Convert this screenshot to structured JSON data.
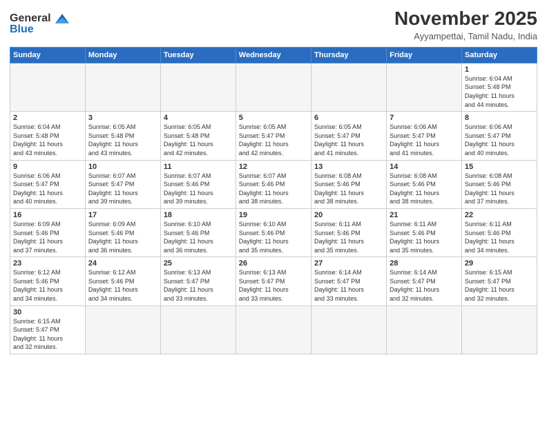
{
  "logo": {
    "general": "General",
    "blue": "Blue"
  },
  "header": {
    "month_title": "November 2025",
    "subtitle": "Ayyampettai, Tamil Nadu, India"
  },
  "days_of_week": [
    "Sunday",
    "Monday",
    "Tuesday",
    "Wednesday",
    "Thursday",
    "Friday",
    "Saturday"
  ],
  "weeks": [
    [
      {
        "day": "",
        "info": ""
      },
      {
        "day": "",
        "info": ""
      },
      {
        "day": "",
        "info": ""
      },
      {
        "day": "",
        "info": ""
      },
      {
        "day": "",
        "info": ""
      },
      {
        "day": "",
        "info": ""
      },
      {
        "day": "1",
        "info": "Sunrise: 6:04 AM\nSunset: 5:48 PM\nDaylight: 11 hours\nand 44 minutes."
      }
    ],
    [
      {
        "day": "2",
        "info": "Sunrise: 6:04 AM\nSunset: 5:48 PM\nDaylight: 11 hours\nand 43 minutes."
      },
      {
        "day": "3",
        "info": "Sunrise: 6:05 AM\nSunset: 5:48 PM\nDaylight: 11 hours\nand 43 minutes."
      },
      {
        "day": "4",
        "info": "Sunrise: 6:05 AM\nSunset: 5:48 PM\nDaylight: 11 hours\nand 42 minutes."
      },
      {
        "day": "5",
        "info": "Sunrise: 6:05 AM\nSunset: 5:47 PM\nDaylight: 11 hours\nand 42 minutes."
      },
      {
        "day": "6",
        "info": "Sunrise: 6:05 AM\nSunset: 5:47 PM\nDaylight: 11 hours\nand 41 minutes."
      },
      {
        "day": "7",
        "info": "Sunrise: 6:06 AM\nSunset: 5:47 PM\nDaylight: 11 hours\nand 41 minutes."
      },
      {
        "day": "8",
        "info": "Sunrise: 6:06 AM\nSunset: 5:47 PM\nDaylight: 11 hours\nand 40 minutes."
      }
    ],
    [
      {
        "day": "9",
        "info": "Sunrise: 6:06 AM\nSunset: 5:47 PM\nDaylight: 11 hours\nand 40 minutes."
      },
      {
        "day": "10",
        "info": "Sunrise: 6:07 AM\nSunset: 5:47 PM\nDaylight: 11 hours\nand 39 minutes."
      },
      {
        "day": "11",
        "info": "Sunrise: 6:07 AM\nSunset: 5:46 PM\nDaylight: 11 hours\nand 39 minutes."
      },
      {
        "day": "12",
        "info": "Sunrise: 6:07 AM\nSunset: 5:46 PM\nDaylight: 11 hours\nand 38 minutes."
      },
      {
        "day": "13",
        "info": "Sunrise: 6:08 AM\nSunset: 5:46 PM\nDaylight: 11 hours\nand 38 minutes."
      },
      {
        "day": "14",
        "info": "Sunrise: 6:08 AM\nSunset: 5:46 PM\nDaylight: 11 hours\nand 38 minutes."
      },
      {
        "day": "15",
        "info": "Sunrise: 6:08 AM\nSunset: 5:46 PM\nDaylight: 11 hours\nand 37 minutes."
      }
    ],
    [
      {
        "day": "16",
        "info": "Sunrise: 6:09 AM\nSunset: 5:46 PM\nDaylight: 11 hours\nand 37 minutes."
      },
      {
        "day": "17",
        "info": "Sunrise: 6:09 AM\nSunset: 5:46 PM\nDaylight: 11 hours\nand 36 minutes."
      },
      {
        "day": "18",
        "info": "Sunrise: 6:10 AM\nSunset: 5:46 PM\nDaylight: 11 hours\nand 36 minutes."
      },
      {
        "day": "19",
        "info": "Sunrise: 6:10 AM\nSunset: 5:46 PM\nDaylight: 11 hours\nand 35 minutes."
      },
      {
        "day": "20",
        "info": "Sunrise: 6:11 AM\nSunset: 5:46 PM\nDaylight: 11 hours\nand 35 minutes."
      },
      {
        "day": "21",
        "info": "Sunrise: 6:11 AM\nSunset: 5:46 PM\nDaylight: 11 hours\nand 35 minutes."
      },
      {
        "day": "22",
        "info": "Sunrise: 6:11 AM\nSunset: 5:46 PM\nDaylight: 11 hours\nand 34 minutes."
      }
    ],
    [
      {
        "day": "23",
        "info": "Sunrise: 6:12 AM\nSunset: 5:46 PM\nDaylight: 11 hours\nand 34 minutes."
      },
      {
        "day": "24",
        "info": "Sunrise: 6:12 AM\nSunset: 5:46 PM\nDaylight: 11 hours\nand 34 minutes."
      },
      {
        "day": "25",
        "info": "Sunrise: 6:13 AM\nSunset: 5:47 PM\nDaylight: 11 hours\nand 33 minutes."
      },
      {
        "day": "26",
        "info": "Sunrise: 6:13 AM\nSunset: 5:47 PM\nDaylight: 11 hours\nand 33 minutes."
      },
      {
        "day": "27",
        "info": "Sunrise: 6:14 AM\nSunset: 5:47 PM\nDaylight: 11 hours\nand 33 minutes."
      },
      {
        "day": "28",
        "info": "Sunrise: 6:14 AM\nSunset: 5:47 PM\nDaylight: 11 hours\nand 32 minutes."
      },
      {
        "day": "29",
        "info": "Sunrise: 6:15 AM\nSunset: 5:47 PM\nDaylight: 11 hours\nand 32 minutes."
      }
    ],
    [
      {
        "day": "30",
        "info": "Sunrise: 6:15 AM\nSunset: 5:47 PM\nDaylight: 11 hours\nand 32 minutes."
      },
      {
        "day": "",
        "info": ""
      },
      {
        "day": "",
        "info": ""
      },
      {
        "day": "",
        "info": ""
      },
      {
        "day": "",
        "info": ""
      },
      {
        "day": "",
        "info": ""
      },
      {
        "day": "",
        "info": ""
      }
    ]
  ]
}
